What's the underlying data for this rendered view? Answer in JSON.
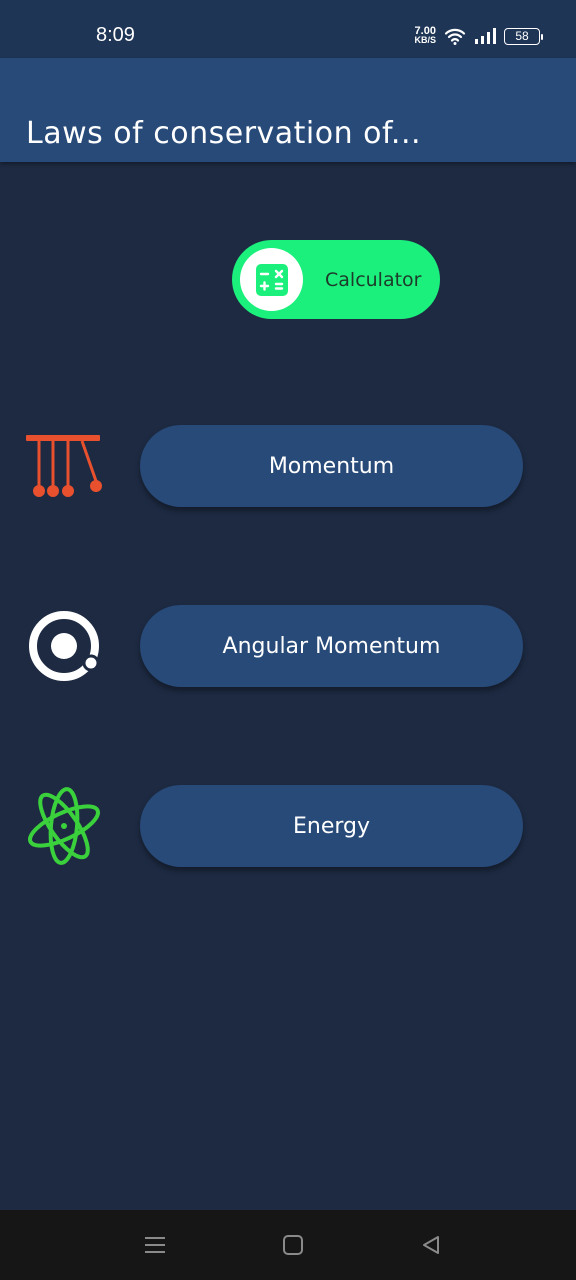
{
  "status_bar": {
    "time": "8:09",
    "net_speed_value": "7.00",
    "net_speed_unit": "KB/S",
    "battery": "58",
    "icons": [
      "wifi-icon",
      "signal-icon",
      "battery-icon"
    ]
  },
  "app_bar": {
    "title": "Laws of conservation of..."
  },
  "calculator": {
    "label": "Calculator",
    "icon": "calculator-icon",
    "color": "#1cf07c"
  },
  "laws": [
    {
      "label": "Momentum",
      "icon": "newtons-cradle-icon",
      "icon_color": "#e8502e"
    },
    {
      "label": "Angular Momentum",
      "icon": "orbit-ring-icon",
      "icon_color": "#ffffff"
    },
    {
      "label": "Energy",
      "icon": "atom-icon",
      "icon_color": "#3ad13c"
    }
  ],
  "navigation": {
    "icons": [
      "menu-icon",
      "home-icon",
      "back-icon"
    ]
  },
  "colors": {
    "background": "#1d2a42",
    "app_bar": "#274a78",
    "button": "#284a78"
  }
}
